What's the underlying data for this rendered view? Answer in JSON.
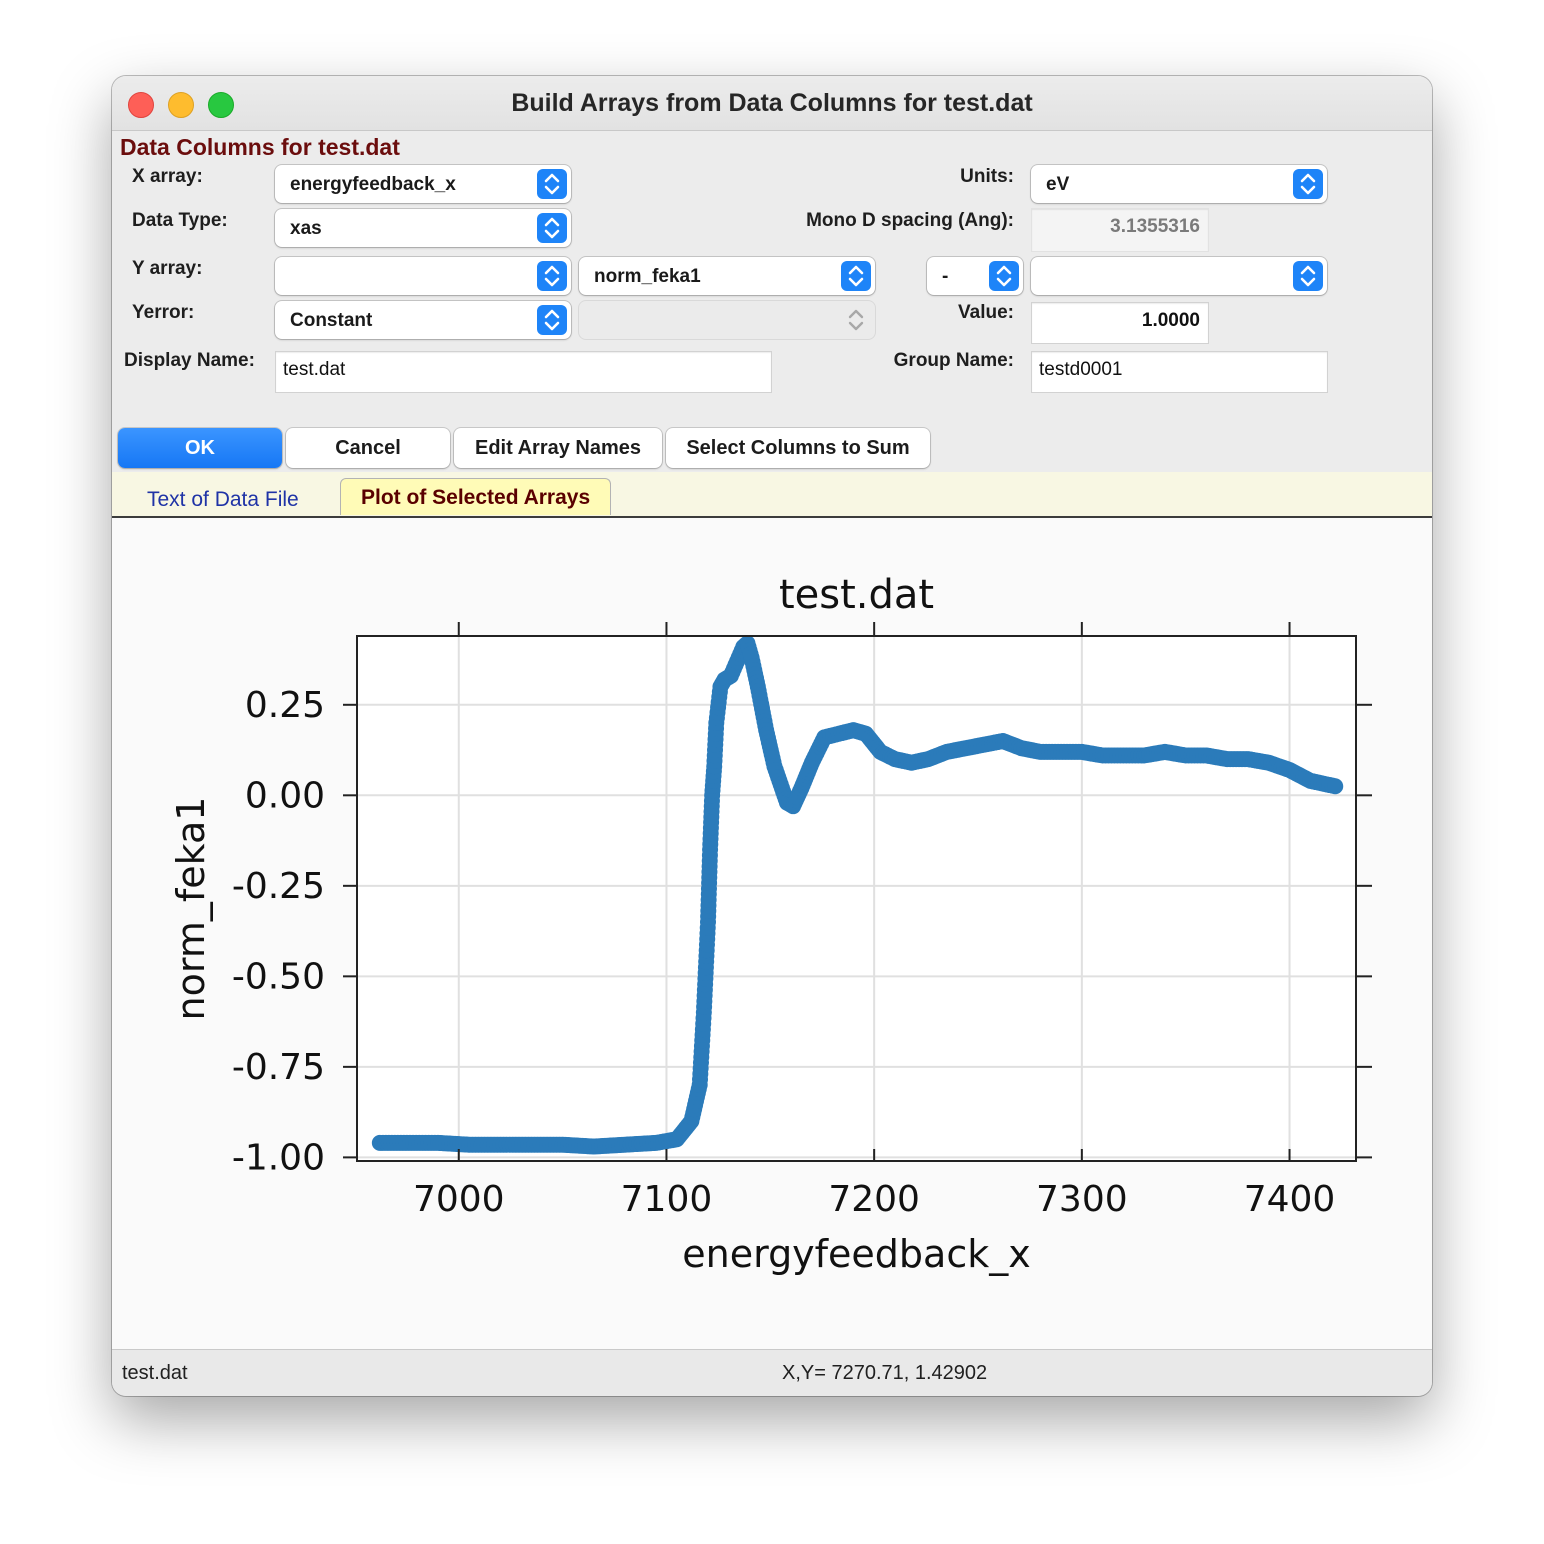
{
  "window": {
    "title": "Build Arrays from Data Columns for test.dat",
    "section_title": "Data Columns for test.dat"
  },
  "form": {
    "x_array": {
      "label": "X array:",
      "value": "energyfeedback_x"
    },
    "data_type": {
      "label": "Data Type:",
      "value": "xas"
    },
    "y_array": {
      "label": "Y array:",
      "value1": "",
      "value2": "norm_feka1",
      "op": "-",
      "value3": ""
    },
    "yerror": {
      "label": "Yerror:",
      "value": "Constant",
      "value2": ""
    },
    "display_name": {
      "label": "Display Name:",
      "value": "test.dat"
    },
    "units": {
      "label": "Units:",
      "value": "eV"
    },
    "mono_d": {
      "label": "Mono D spacing (Ang):",
      "value": "3.1355316"
    },
    "value": {
      "label": "Value:",
      "value": "1.0000"
    },
    "group_name": {
      "label": "Group Name:",
      "value": "testd0001"
    }
  },
  "buttons": {
    "ok": "OK",
    "cancel": "Cancel",
    "edit_names": "Edit Array Names",
    "select_sum": "Select Columns to Sum"
  },
  "tabs": {
    "text_tab": "Text of Data File",
    "plot_tab": "Plot of Selected Arrays"
  },
  "status": {
    "left": "test.dat",
    "coords": "X,Y= 7270.71, 1.42902"
  },
  "colors": {
    "accent": "#1e84f8",
    "series": "#2b7bba",
    "section_title": "#6b0d0d"
  },
  "chart_data": {
    "type": "scatter",
    "title": "test.dat",
    "xlabel": "energyfeedback_x",
    "ylabel": "norm_feka1",
    "xlim": [
      6951,
      7432
    ],
    "ylim": [
      -1.01,
      0.44
    ],
    "xticks": [
      7000,
      7100,
      7200,
      7300,
      7400
    ],
    "xtick_labels": [
      "7000",
      "7100",
      "7200",
      "7300",
      "7400"
    ],
    "yticks": [
      -1.0,
      -0.75,
      -0.5,
      -0.25,
      0.0,
      0.25
    ],
    "ytick_labels": [
      "-1.00",
      "-0.75",
      "-0.50",
      "-0.25",
      "0.00",
      "0.25"
    ],
    "grid": true,
    "series": [
      {
        "x": [
          6962,
          6975,
          6990,
          7005,
          7020,
          7035,
          7050,
          7065,
          7080,
          7095,
          7105,
          7112,
          7116,
          7118,
          7120,
          7121,
          7122,
          7123,
          7124,
          7126,
          7128,
          7131,
          7134,
          7137,
          7139,
          7141,
          7144,
          7148,
          7152,
          7155,
          7158,
          7161,
          7165,
          7170,
          7176,
          7183,
          7190,
          7196,
          7203,
          7210,
          7218,
          7226,
          7235,
          7244,
          7253,
          7262,
          7271,
          7280,
          7290,
          7300,
          7310,
          7320,
          7330,
          7340,
          7350,
          7360,
          7370,
          7380,
          7390,
          7400,
          7410,
          7422
        ],
        "y": [
          -0.96,
          -0.96,
          -0.96,
          -0.965,
          -0.965,
          -0.965,
          -0.965,
          -0.97,
          -0.965,
          -0.96,
          -0.95,
          -0.9,
          -0.8,
          -0.6,
          -0.35,
          -0.15,
          0.0,
          0.08,
          0.2,
          0.3,
          0.32,
          0.33,
          0.37,
          0.41,
          0.42,
          0.38,
          0.3,
          0.18,
          0.08,
          0.03,
          -0.02,
          -0.03,
          0.02,
          0.09,
          0.16,
          0.17,
          0.18,
          0.17,
          0.12,
          0.1,
          0.09,
          0.1,
          0.12,
          0.13,
          0.14,
          0.15,
          0.13,
          0.12,
          0.12,
          0.12,
          0.11,
          0.11,
          0.11,
          0.12,
          0.11,
          0.11,
          0.1,
          0.1,
          0.09,
          0.07,
          0.04,
          0.025
        ]
      }
    ]
  }
}
